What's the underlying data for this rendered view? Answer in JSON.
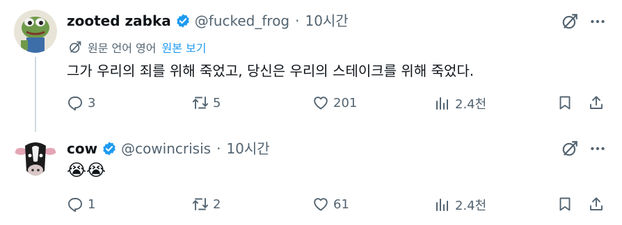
{
  "tweets": [
    {
      "name": "zooted zabka",
      "handle": "@fucked_frog",
      "separator": "·",
      "time": "10시간",
      "translate_label": "원문 언어 영어",
      "translate_link": "원본 보기",
      "text": "그가 우리의 죄를 위해 죽었고, 당신은 우리의 스테이크를 위해 죽었다.",
      "reply_count": "3",
      "retweet_count": "5",
      "like_count": "201",
      "view_count": "2.4천"
    },
    {
      "name": "cow",
      "handle": "@cowincrisis",
      "separator": "·",
      "time": "10시간",
      "text": "😭😭",
      "reply_count": "1",
      "retweet_count": "2",
      "like_count": "61",
      "view_count": "2.4천"
    }
  ],
  "colors": {
    "verified": "#1d9bf0",
    "link": "#1d9bf0",
    "muted": "#536471",
    "text": "#0f1419"
  },
  "icons": [
    "grok-icon",
    "more-icon",
    "reply-icon",
    "retweet-icon",
    "like-icon",
    "views-icon",
    "bookmark-icon",
    "share-icon",
    "translate-icon",
    "verified-badge-icon"
  ]
}
